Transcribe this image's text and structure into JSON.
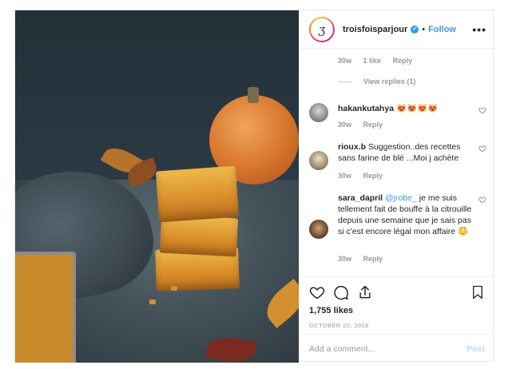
{
  "post": {
    "username": "troisfoisparjour",
    "avatar_letter": "ʒ",
    "verified": "✔",
    "dot": "•",
    "follow_label": "Follow",
    "more_label": "•••",
    "photo_icon": "food-photo-pumpkin-cake"
  },
  "thread": {
    "first_reply_meta": {
      "time": "30w",
      "likes": "1 like",
      "reply": "Reply"
    },
    "view_replies": "View replies (1)"
  },
  "comments": [
    {
      "user": "hakankutahya",
      "text": "😻😻😻😻",
      "mention": "",
      "time": "30w",
      "reply": "Reply"
    },
    {
      "user": "rioux.b",
      "text": "Suggestion..des recettes sans farine de blé ...Moi j achète",
      "mention": "",
      "time": "30w",
      "reply": "Reply"
    },
    {
      "user": "sara_dapril",
      "mention": "@jrobe_",
      "text": "je me suis tellement fait de bouffe à la citrouille depuis une semaine que je sais pas si c'est encore légal mon affaire 😳",
      "time": "30w",
      "reply": "Reply"
    }
  ],
  "footer": {
    "likes": "1,755 likes",
    "date": "OCTOBER 20, 2018",
    "add_comment_placeholder": "Add a comment...",
    "post_label": "Post"
  },
  "colors": {
    "accent": "#3897f0",
    "muted": "#999999",
    "post_disabled": "#b2dffc"
  }
}
